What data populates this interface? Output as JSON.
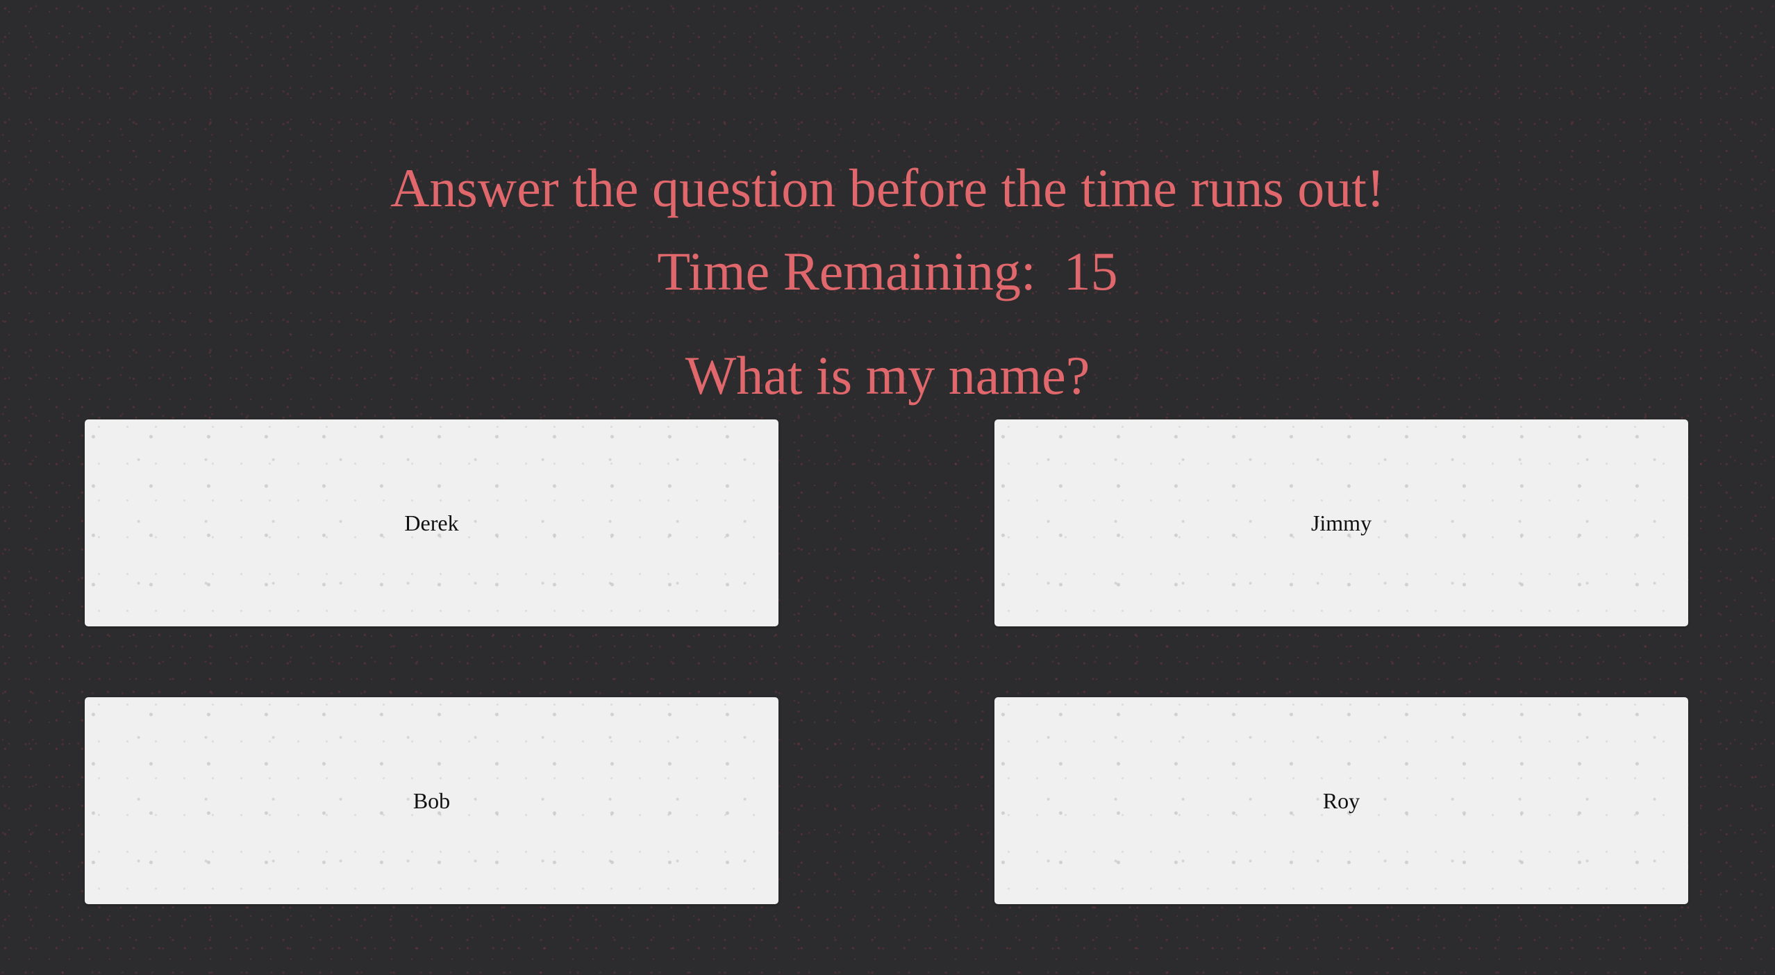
{
  "heading": "Answer the question before the time runs out!",
  "timer": {
    "label": "Time Remaining:",
    "value": "15"
  },
  "question": "What is my name?",
  "answers": [
    {
      "label": "Derek"
    },
    {
      "label": "Jimmy"
    },
    {
      "label": "Bob"
    },
    {
      "label": "Roy"
    }
  ],
  "colors": {
    "background": "#2c2b2d",
    "accent_text": "#e0676c",
    "answer_card": "#f0f0f0",
    "answer_text": "#111111"
  }
}
